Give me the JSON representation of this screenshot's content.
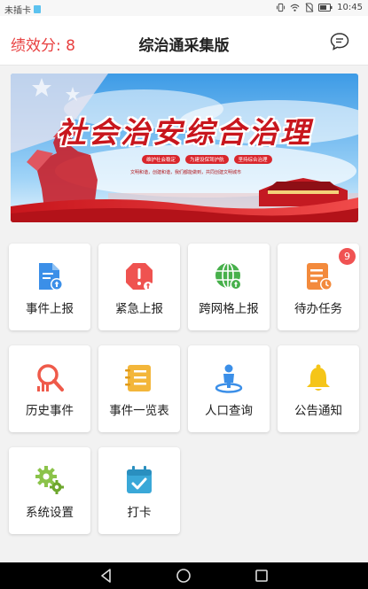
{
  "status_bar": {
    "carrier": "未插卡",
    "time": "10:45"
  },
  "header": {
    "score_label": "绩效分: 8",
    "title": "综治通采集版",
    "message_icon": "chat-bubble-icon"
  },
  "banner": {
    "title": "社会治安综合治理",
    "tags": [
      "维护社会稳定",
      "为建设保驾护航",
      "坚持综合治理"
    ],
    "subtitle": "文明和谐，创建和谐，我们都能做到，共同创建文明城市",
    "colors": {
      "sky": "#4aa8e8",
      "red": "#d61e25"
    }
  },
  "tiles": [
    {
      "label": "事件上报",
      "icon": "document-upload-icon",
      "color": "#3b8fe8"
    },
    {
      "label": "紧急上报",
      "icon": "alert-octagon-icon",
      "color": "#ef5350"
    },
    {
      "label": "跨网格上报",
      "icon": "globe-upload-icon",
      "color": "#47b04b"
    },
    {
      "label": "待办任务",
      "icon": "task-clock-icon",
      "color": "#f38a3c",
      "badge": "9"
    },
    {
      "label": "历史事件",
      "icon": "search-chart-icon",
      "color": "#ef5a4a"
    },
    {
      "label": "事件一览表",
      "icon": "list-notebook-icon",
      "color": "#f3b63a"
    },
    {
      "label": "人口查询",
      "icon": "person-location-icon",
      "color": "#3b8fe8"
    },
    {
      "label": "公告通知",
      "icon": "bell-icon",
      "color": "#f5c518"
    },
    {
      "label": "系统设置",
      "icon": "gears-icon",
      "color": "#8bc34a"
    },
    {
      "label": "打卡",
      "icon": "calendar-check-icon",
      "color": "#3aa8d8"
    }
  ]
}
